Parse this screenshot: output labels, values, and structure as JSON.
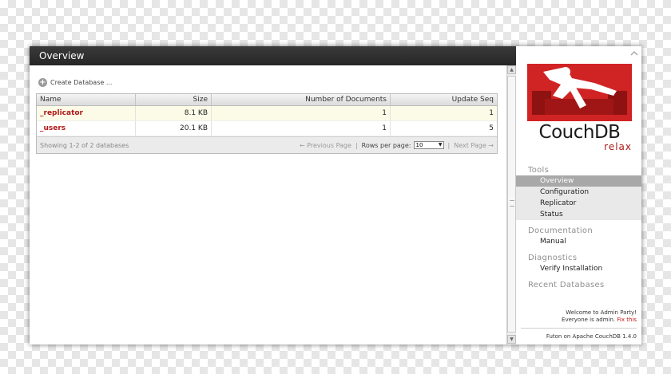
{
  "main": {
    "title": "Overview",
    "create_database_label": "Create Database ...",
    "table": {
      "columns": [
        "Name",
        "Size",
        "Number of Documents",
        "Update Seq"
      ],
      "rows": [
        {
          "name": "_replicator",
          "size": "8.1 KB",
          "docs": "1",
          "seq": "1"
        },
        {
          "name": "_users",
          "size": "20.1 KB",
          "docs": "1",
          "seq": "5"
        }
      ]
    },
    "footer": {
      "showing": "Showing 1-2 of 2 databases",
      "previous": "← Previous Page",
      "rows_per_page_label": "Rows per page:",
      "rows_per_page_value": "10",
      "next": "Next Page →"
    }
  },
  "sidebar": {
    "logo_text": "CouchDB",
    "logo_sub": "relax",
    "sections": {
      "tools": {
        "heading": "Tools",
        "items": [
          "Overview",
          "Configuration",
          "Replicator",
          "Status"
        ]
      },
      "documentation": {
        "heading": "Documentation",
        "items": [
          "Manual"
        ]
      },
      "diagnostics": {
        "heading": "Diagnostics",
        "items": [
          "Verify Installation"
        ]
      },
      "recent": {
        "heading": "Recent Databases"
      }
    },
    "welcome_line1": "Welcome to Admin Party!",
    "welcome_line2": "Everyone is admin.",
    "fix_link": "Fix this",
    "footer": "Futon on Apache CouchDB 1.4.0"
  },
  "colors": {
    "accent_red": "#b01818",
    "title_bar": "#2e2e2e",
    "selected_nav": "#a8a8a8"
  },
  "icons": {
    "create": "plus-circle-icon",
    "collapse": "chevron-up-icon",
    "scroll_up": "arrow-up-icon",
    "scroll_down": "arrow-down-icon"
  }
}
